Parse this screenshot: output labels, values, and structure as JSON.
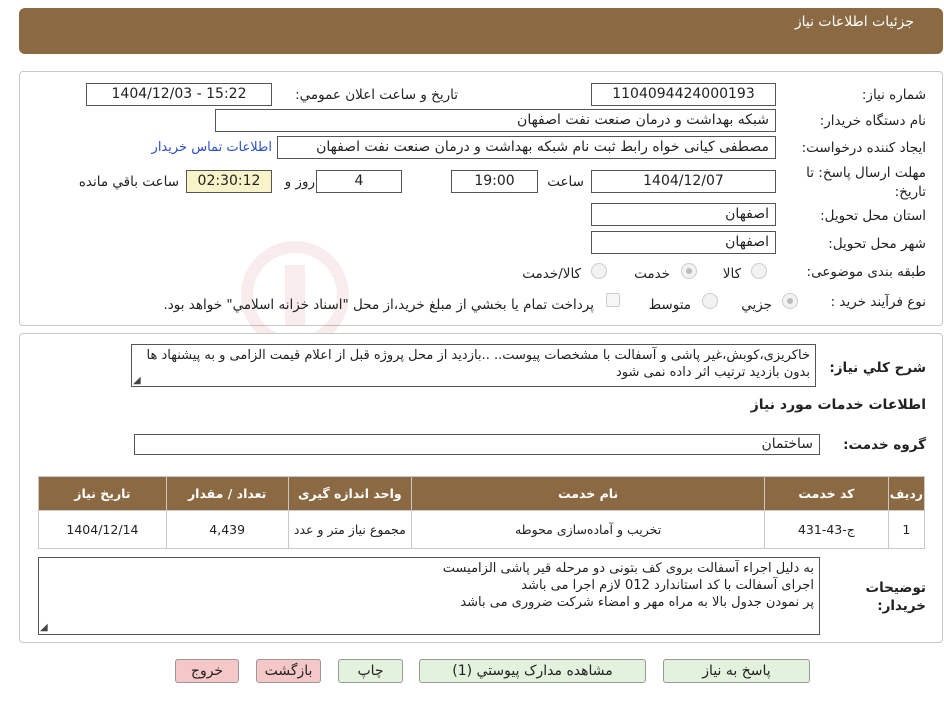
{
  "header": {
    "title": "جزئیات اطلاعات نیاز"
  },
  "form": {
    "need_number_label": "شماره نیاز:",
    "need_number": "1104094424000193",
    "announce_label": "تاریخ و ساعت اعلان عمومي:",
    "announce_value": "1404/12/03 - 15:22",
    "buyer_org_label": "نام دستگاه خريدار:",
    "buyer_org": "شبکه بهداشت و درمان صنعت نفت اصفهان",
    "requester_label": "ايجاد کننده درخواست:",
    "requester": "مصطفی کیانی خواه رابط ثبت نام شبکه بهداشت و درمان صنعت نفت اصفهان",
    "contact_link": "اطلاعات تماس خريدار",
    "deadline_label": "مهلت ارسال پاسخ: تا تاريخ:",
    "deadline_date": "1404/12/07",
    "time_label": "ساعت",
    "deadline_time": "19:00",
    "days_value": "4",
    "days_label": "روز و",
    "remaining_time": "02:30:12",
    "remaining_label": "ساعت باقي مانده",
    "province_label": "استان محل تحويل:",
    "province": "اصفهان",
    "city_label": "شهر محل تحويل:",
    "city": "اصفهان",
    "category_label": "طبقه بندی موضوعی:",
    "category_options": [
      "کالا",
      "خدمت",
      "کالا/خدمت"
    ],
    "category_selected": "خدمت",
    "process_label": "نوع فرآیند خرید :",
    "process_options": [
      "جزيي",
      "متوسط"
    ],
    "process_selected": "جزيي",
    "payment_note": "پرداخت تمام يا بخشي از مبلغ خريد،از محل \"اسناد خزانه اسلامي\" خواهد بود."
  },
  "summary": {
    "label": "شرح کلي نياز:",
    "text": "خاکریزی،کوبش،غیر پاشی و آسفالت با مشخصات پیوست.. ..بازدید از محل پروژه قبل از اعلام قیمت الزامی و به پیشنهاد ها بدون بازدید ترتیب اثر داده نمی شود"
  },
  "services": {
    "section_title": "اطلاعات خدمات مورد نياز",
    "group_label": "گروه خدمت:",
    "group_value": "ساختمان",
    "columns": [
      "رديف",
      "کد خدمت",
      "نام خدمت",
      "واحد اندازه گيری",
      "تعداد / مقدار",
      "تاريخ نياز"
    ],
    "rows": [
      {
        "row": "1",
        "code": "ج-43-431",
        "name": "تخريب و آماده‌سازی محوطه",
        "unit": "مجموع نياز متر و عدد",
        "qty": "4,439",
        "date": "1404/12/14"
      }
    ]
  },
  "buyer_notes": {
    "label": "توضيحات خريدار:",
    "lines": [
      "به دلیل اجراء آسفالت بروی کف بتونی دو مرحله قیر پاشی الزامیست",
      "اجرای آسفالت با کد استاندارد 012  لازم اجرا می باشد",
      "پر نمودن جدول بالا به مراه مهر و امضاء شرکت ضروری می باشد"
    ]
  },
  "buttons": {
    "reply": "پاسخ به نياز",
    "attachments": "مشاهده مدارک پيوستي (1)",
    "print": "چاپ",
    "back": "بازگشت",
    "exit": "خروج"
  },
  "colors": {
    "header_bg": "#8b6a43",
    "button_green": "#e2f2dc",
    "button_red": "#f5c7c7",
    "link": "#2a50c8"
  }
}
